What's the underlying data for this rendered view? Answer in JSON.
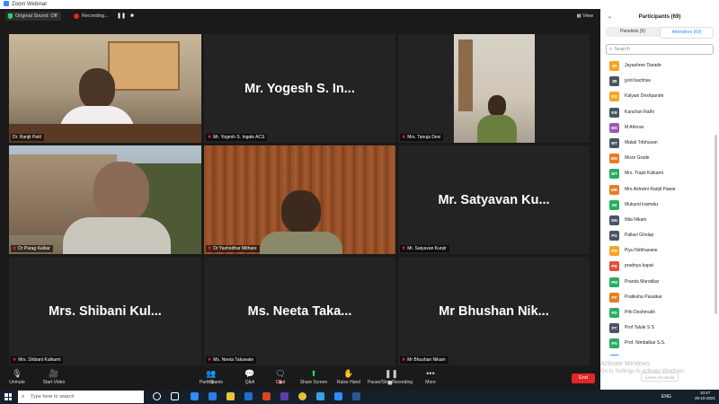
{
  "window": {
    "title": "Zoom Webinar"
  },
  "topbar": {
    "sound_label": "Original Sound: Off",
    "recording_label": "Recording...",
    "view_label": "View",
    "rec_pause": "❚❚",
    "rec_stop": "■"
  },
  "tiles": [
    {
      "name": "Dr. Ranjit Patil",
      "big": ""
    },
    {
      "name": "Mr. Yogesh S. Ingale ACS",
      "big": "Mr. Yogesh S. In..."
    },
    {
      "name": "Mrs. Tanuja Devi",
      "big": ""
    },
    {
      "name": "Dr Parag Kalkar",
      "big": ""
    },
    {
      "name": "Dr Yashodhar Mithare",
      "big": ""
    },
    {
      "name": "Mr. Satyavan Kunjir",
      "big": "Mr. Satyavan Ku..."
    },
    {
      "name": "Mrs. Shibani Kulkarni",
      "big": "Mrs. Shibani Kul..."
    },
    {
      "name": "Ms. Neeta Takawale",
      "big": "Ms. Neeta Taka..."
    },
    {
      "name": "Mr Bhushan Nikam",
      "big": "Mr Bhushan Nik..."
    }
  ],
  "toolbar": {
    "unmute": "Unmute",
    "start_video": "Start Video",
    "participants": "Participants",
    "participants_count": "69",
    "qa": "Q&A",
    "chat": "Chat",
    "chat_badge": "1",
    "share": "Share Screen",
    "raise": "Raise Hand",
    "pause_rec": "Pause/Stop Recording",
    "more": "More",
    "end": "End"
  },
  "panel": {
    "title": "Participants (69)",
    "tab_panelists": "Panelists (9)",
    "tab_attendees": "Attendees (60)",
    "search_placeholder": "Search",
    "leave_all": "Leave All Hands",
    "watermark1": "Activate Windows",
    "watermark2": "Go to Settings to activate Windows."
  },
  "attendees": [
    {
      "initials": "JD",
      "name": "Jayashree Darade",
      "color": "#f5a623"
    },
    {
      "initials": "JB",
      "name": "jyoti bachhav",
      "color": "#4a5563"
    },
    {
      "initials": "KD",
      "name": "Kalyani Deshpande",
      "color": "#f5a623"
    },
    {
      "initials": "KR",
      "name": "Kanchan  Rathi",
      "color": "#4a5563"
    },
    {
      "initials": "MA",
      "name": "M Ahirrao",
      "color": "#9b59b6"
    },
    {
      "initials": "MT",
      "name": "Malati Tribhuvan",
      "color": "#4a5563"
    },
    {
      "initials": "MG",
      "name": "Moze Grade",
      "color": "#e67e22"
    },
    {
      "initials": "MT",
      "name": "Mrs. Trupti Kulkarni",
      "color": "#27ae60"
    },
    {
      "initials": "MR",
      "name": "Mrs.Ashwini Ranjit Pawar",
      "color": "#e67e22"
    },
    {
      "initials": "MI",
      "name": "Mukund inamdar",
      "color": "#27ae60"
    },
    {
      "initials": "NN",
      "name": "Nita Nikam",
      "color": "#4a5563"
    },
    {
      "initials": "PG",
      "name": "Pallavi Gholap",
      "color": "#4a5563"
    },
    {
      "initials": "PN",
      "name": "Piyu Nirbhavane",
      "color": "#f5a623"
    },
    {
      "initials": "PB",
      "name": "pradnya bapat",
      "color": "#e74c3c"
    },
    {
      "initials": "PM",
      "name": "Pranita Marodkar",
      "color": "#27ae60"
    },
    {
      "initials": "PP",
      "name": "Pratiksha Pasalkar",
      "color": "#e67e22"
    },
    {
      "initials": "PD",
      "name": "Priti Deshmukh",
      "color": "#27ae60"
    },
    {
      "initials": "PT",
      "name": "Prof Talule S S",
      "color": "#4a5563"
    },
    {
      "initials": "PN",
      "name": "Prof. Nimbalkar S.S.",
      "color": "#27ae60"
    },
    {
      "initials": "PT",
      "name": "Prof. Teja Pathak",
      "color": "#2d8cff"
    }
  ],
  "taskbar": {
    "search_placeholder": "Type here to search",
    "lang": "ENG",
    "time": "10:47",
    "date": "25-10-2021"
  }
}
